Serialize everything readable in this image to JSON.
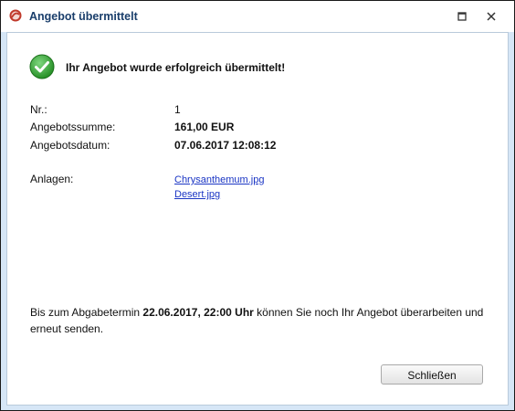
{
  "window": {
    "title": "Angebot übermittelt",
    "app_icon": "app-logo-icon",
    "controls": [
      "maximize-icon",
      "close-icon"
    ]
  },
  "message": {
    "icon": "success-check-icon",
    "headline": "Ihr Angebot wurde erfolgreich übermittelt!"
  },
  "details": {
    "nr_label": "Nr.:",
    "nr_value": "1",
    "sum_label": "Angebotssumme:",
    "sum_value": "161,00 EUR",
    "date_label": "Angebotsdatum:",
    "date_value": "07.06.2017 12:08:12",
    "attachments_label": "Anlagen:",
    "attachments": [
      "Chrysanthemum.jpg",
      "Desert.jpg"
    ]
  },
  "notice": {
    "prefix": "Bis zum Abgabetermin ",
    "deadline": "22.06.2017, 22:00 Uhr",
    "suffix": " können Sie noch Ihr Angebot überarbeiten und erneut senden."
  },
  "buttons": {
    "close_label": "Schließen"
  },
  "colors": {
    "title": "#1a3e6b",
    "link": "#1a35c4",
    "success": "#2e9e2e",
    "frame": "#d6e6f6"
  }
}
